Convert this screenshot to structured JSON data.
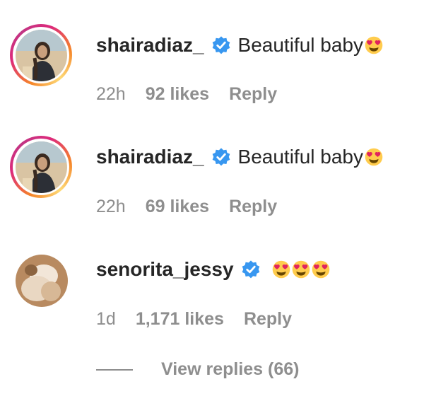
{
  "comments": [
    {
      "username": "shairadiaz_",
      "verified": true,
      "text": "Beautiful baby",
      "emoji": [
        "heart-eyes"
      ],
      "time": "22h",
      "likes": "92 likes",
      "reply_label": "Reply",
      "has_story_ring": true
    },
    {
      "username": "shairadiaz_",
      "verified": true,
      "text": "Beautiful baby",
      "emoji": [
        "heart-eyes"
      ],
      "time": "22h",
      "likes": "69 likes",
      "reply_label": "Reply",
      "has_story_ring": true
    },
    {
      "username": "senorita_jessy",
      "verified": true,
      "text": "",
      "emoji": [
        "heart-eyes",
        "heart-eyes",
        "heart-eyes"
      ],
      "time": "1d",
      "likes": "1,171 likes",
      "reply_label": "Reply",
      "has_story_ring": false
    }
  ],
  "view_replies": {
    "label": "View replies (66)"
  },
  "colors": {
    "text_primary": "#262626",
    "text_secondary": "#8e8e8e",
    "verified_blue": "#3897f0",
    "emoji_yellow": "#ffcc4d",
    "heart_red": "#e0245e"
  }
}
